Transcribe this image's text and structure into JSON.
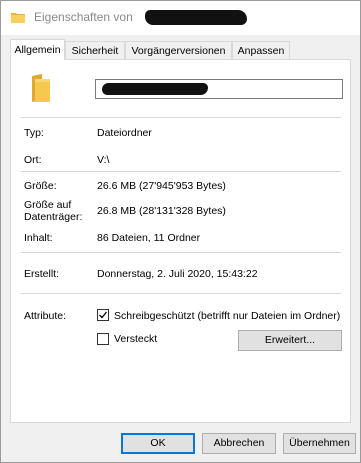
{
  "window": {
    "title_prefix": "Eigenschaften von"
  },
  "tabs": [
    {
      "label": "Allgemein",
      "active": true
    },
    {
      "label": "Sicherheit",
      "active": false
    },
    {
      "label": "Vorgängerversionen",
      "active": false
    },
    {
      "label": "Anpassen",
      "active": false
    }
  ],
  "general": {
    "type_label": "Typ:",
    "type_value": "Dateiordner",
    "location_label": "Ort:",
    "location_value": "V:\\",
    "size_label": "Größe:",
    "size_value": "26.6 MB (27'945'953 Bytes)",
    "size_on_disk_label_line1": "Größe auf",
    "size_on_disk_label_line2": "Datenträger:",
    "size_on_disk_value": "26.8 MB (28'131'328 Bytes)",
    "contents_label": "Inhalt:",
    "contents_value": "86 Dateien, 11 Ordner",
    "created_label": "Erstellt:",
    "created_value": "Donnerstag, 2. Juli 2020, 15:43:22",
    "attributes_label": "Attribute:",
    "readonly_label": "Schreibgeschützt (betrifft nur Dateien im Ordner)",
    "readonly_checked": true,
    "hidden_label": "Versteckt",
    "hidden_checked": false,
    "advanced_button": "Erweitert..."
  },
  "footer": {
    "ok_label": "OK",
    "cancel_label": "Abbrechen",
    "apply_label": "Übernehmen"
  },
  "colors": {
    "folder": "#f4c44a",
    "accent": "#0078d7"
  },
  "icons": {
    "title": "folder-icon",
    "large": "folder-icon",
    "check": "checkmark-icon"
  }
}
